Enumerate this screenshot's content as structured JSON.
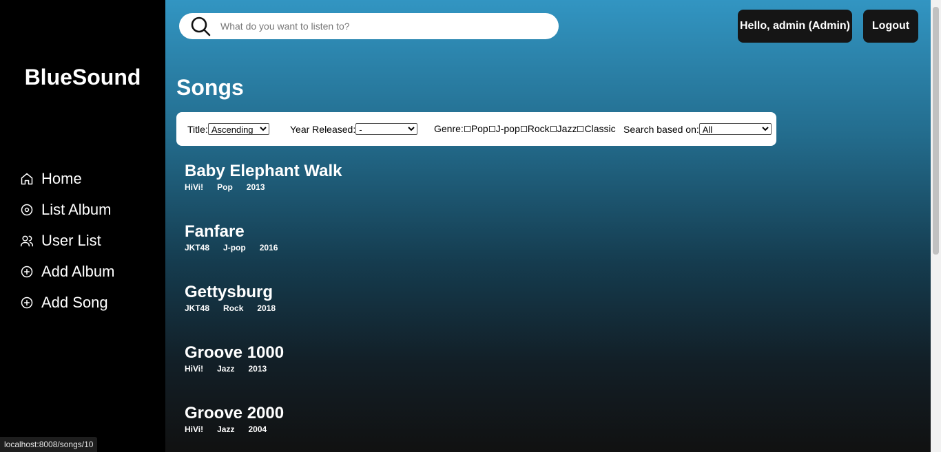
{
  "sidebar": {
    "brand": "BlueSound",
    "items": [
      {
        "label": "Home",
        "icon": "home-icon"
      },
      {
        "label": "List Album",
        "icon": "disc-icon"
      },
      {
        "label": "User List",
        "icon": "users-icon"
      },
      {
        "label": "Add Album",
        "icon": "plus-circle-icon"
      },
      {
        "label": "Add Song",
        "icon": "plus-circle-icon"
      }
    ]
  },
  "header": {
    "search_placeholder": "What do you want to listen to?",
    "search_icon": "search-icon",
    "greeting": "Hello, admin (Admin)",
    "logout": "Logout"
  },
  "page": {
    "title": "Songs"
  },
  "filters": {
    "title_label": "Title:",
    "title_value": "Ascending",
    "year_label": "Year Released:",
    "year_value": "-",
    "genre_label": "Genre:",
    "genres": [
      "Pop",
      "J-pop",
      "Rock",
      "Jazz",
      "Classic"
    ],
    "search_label": "Search based on:",
    "search_value": "All"
  },
  "songs": [
    {
      "title": "Baby Elephant Walk",
      "artist": "HiVi!",
      "genre": "Pop",
      "year": "2013"
    },
    {
      "title": "Fanfare",
      "artist": "JKT48",
      "genre": "J-pop",
      "year": "2016"
    },
    {
      "title": "Gettysburg",
      "artist": "JKT48",
      "genre": "Rock",
      "year": "2018"
    },
    {
      "title": "Groove 1000",
      "artist": "HiVi!",
      "genre": "Jazz",
      "year": "2013"
    },
    {
      "title": "Groove 2000",
      "artist": "HiVi!",
      "genre": "Jazz",
      "year": "2004"
    }
  ],
  "status_url": "localhost:8008/songs/10",
  "colors": {
    "sidebar": "#000000",
    "gradient_top": "#3295c2",
    "gradient_bottom": "#111111",
    "button": "#151515"
  }
}
